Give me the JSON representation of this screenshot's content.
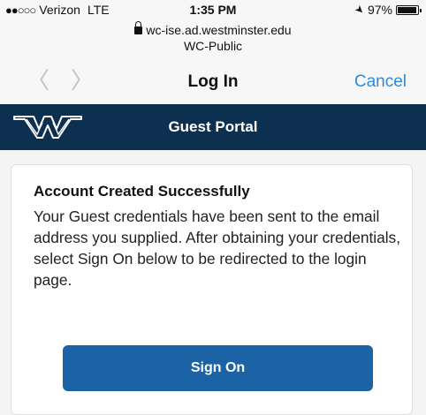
{
  "status_bar": {
    "carrier": "Verizon",
    "network_type": "LTE",
    "time": "1:35 PM",
    "battery": "97%",
    "battery_level": 0.97
  },
  "browser": {
    "url": "wc-ise.ad.westminster.edu",
    "network_name": "WC-Public",
    "page_title": "Log In",
    "cancel_label": "Cancel",
    "back_icon": "chevron-left-icon",
    "forward_icon": "chevron-right-icon"
  },
  "portal": {
    "title": "Guest Portal",
    "logo": "westminster-w-logo",
    "bar_color": "#0d3050"
  },
  "card": {
    "heading": "Account Created Successfully",
    "body": "Your Guest credentials have been sent to the email address you supplied. After obtaining your credentials, select Sign On below to be redirected to the login page.",
    "button_label": "Sign On",
    "button_color": "#1c63a6"
  },
  "colors": {
    "accent": "#2f8bd6"
  }
}
